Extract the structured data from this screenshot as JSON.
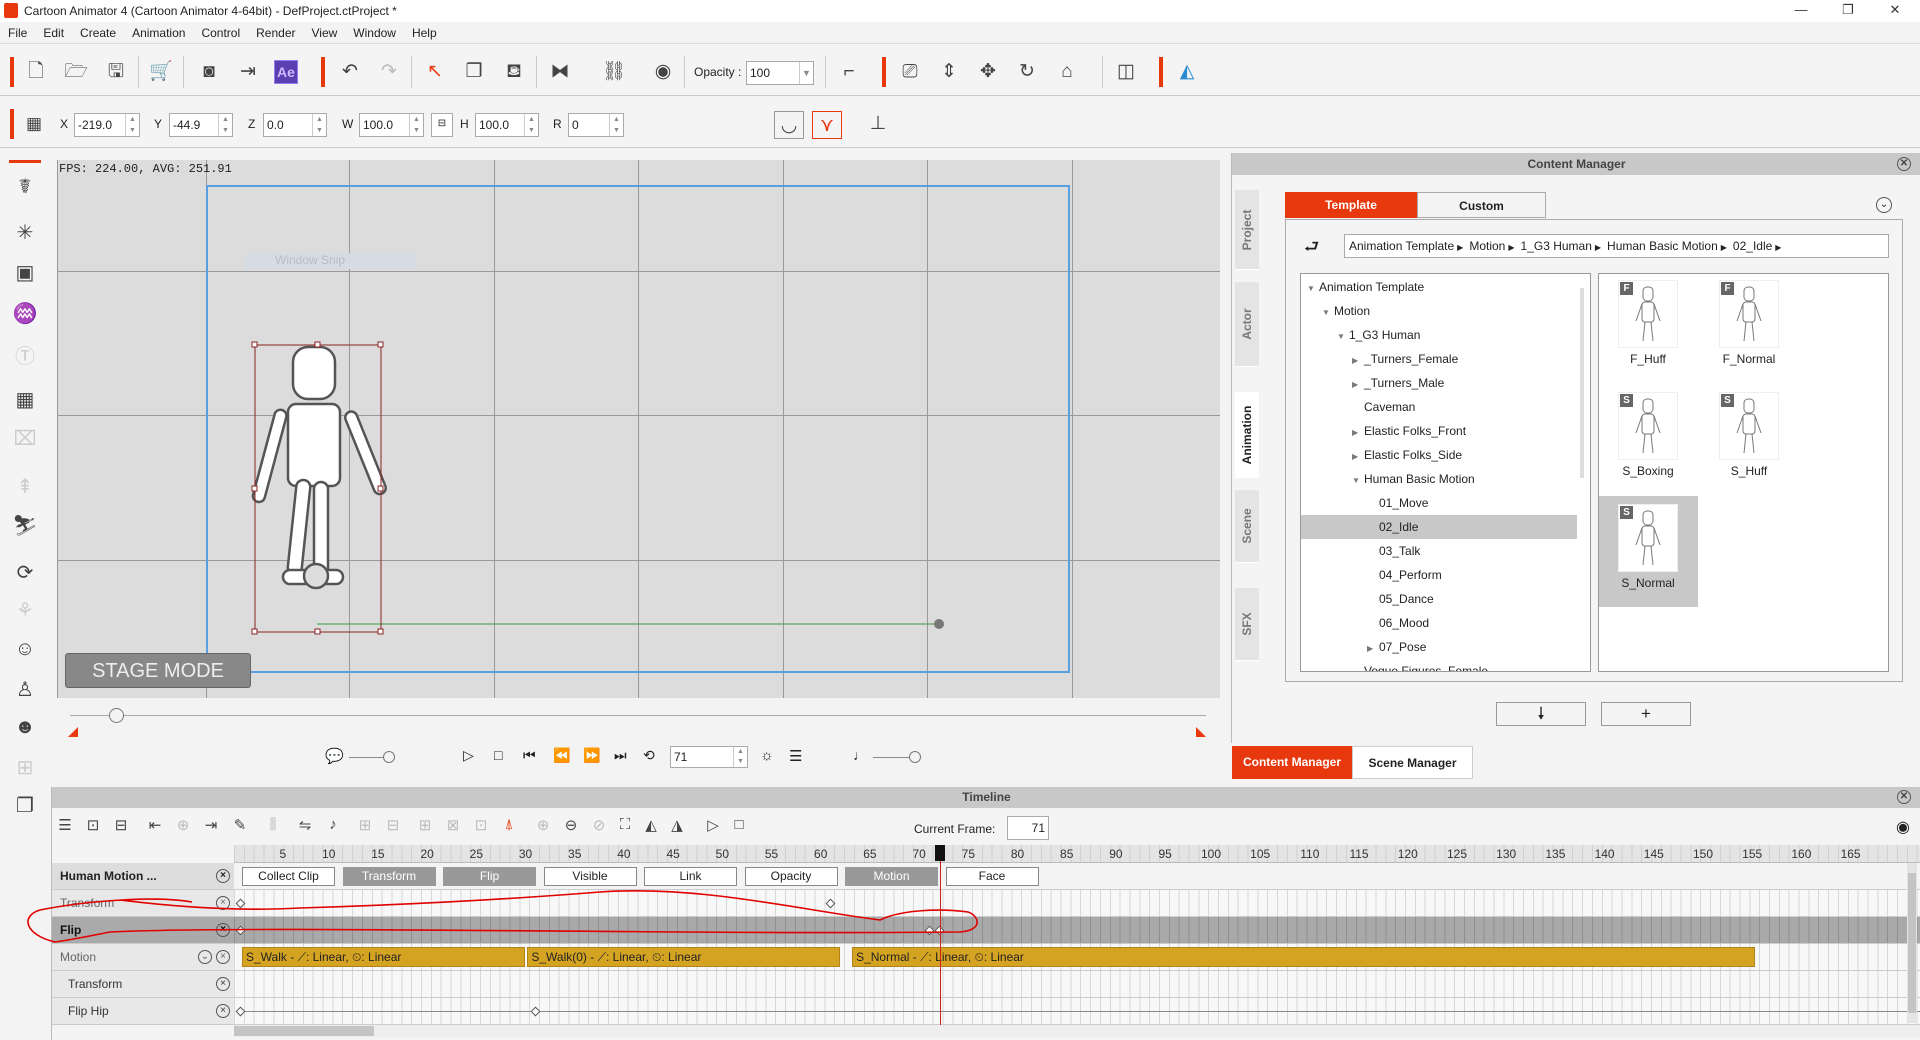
{
  "window": {
    "title": "Cartoon Animator 4  (Cartoon Animator 4-64bit) - DefProject.ctProject *",
    "minimize": "—",
    "restore": "❐",
    "close": "✕"
  },
  "menu": [
    "File",
    "Edit",
    "Create",
    "Animation",
    "Control",
    "Render",
    "View",
    "Window",
    "Help"
  ],
  "toolbar": {
    "opacity_label": "Opacity :",
    "opacity_value": "100",
    "ae_label": "Ae"
  },
  "transform": {
    "x_label": "X",
    "x": "-219.0",
    "y_label": "Y",
    "y": "-44.9",
    "z_label": "Z",
    "z": "0.0",
    "w_label": "W",
    "w": "100.0",
    "h_label": "H",
    "h": "100.0",
    "r_label": "R",
    "r": "0"
  },
  "viewport": {
    "fps": "FPS: 224.00, AVG: 251.91",
    "stage_mode": "STAGE MODE",
    "watermark": "Window Snip"
  },
  "playback": {
    "frame": "71"
  },
  "content_manager": {
    "title": "Content Manager",
    "side_tabs": [
      "Project",
      "Actor",
      "Animation",
      "Scene",
      "SFX"
    ],
    "selected_side_tab": "Animation",
    "tabs": [
      "Template",
      "Custom"
    ],
    "breadcrumb": [
      "Animation Template",
      "Motion",
      "1_G3 Human",
      "Human Basic Motion",
      "02_Idle"
    ],
    "tree": [
      {
        "label": "Animation Template",
        "level": 0,
        "arrow": "down"
      },
      {
        "label": "Motion",
        "level": 1,
        "arrow": "down"
      },
      {
        "label": "1_G3 Human",
        "level": 2,
        "arrow": "down"
      },
      {
        "label": "_Turners_Female",
        "level": 3,
        "arrow": "right"
      },
      {
        "label": "_Turners_Male",
        "level": 3,
        "arrow": "right"
      },
      {
        "label": "Caveman",
        "level": 3,
        "arrow": ""
      },
      {
        "label": "Elastic Folks_Front",
        "level": 3,
        "arrow": "right"
      },
      {
        "label": "Elastic Folks_Side",
        "level": 3,
        "arrow": "right"
      },
      {
        "label": "Human Basic Motion",
        "level": 3,
        "arrow": "down"
      },
      {
        "label": "01_Move",
        "level": 4,
        "arrow": ""
      },
      {
        "label": "02_Idle",
        "level": 4,
        "arrow": "",
        "selected": true
      },
      {
        "label": "03_Talk",
        "level": 4,
        "arrow": ""
      },
      {
        "label": "04_Perform",
        "level": 4,
        "arrow": ""
      },
      {
        "label": "05_Dance",
        "level": 4,
        "arrow": ""
      },
      {
        "label": "06_Mood",
        "level": 4,
        "arrow": ""
      },
      {
        "label": "07_Pose",
        "level": 4,
        "arrow": "right"
      },
      {
        "label": "Vogue Figures_Female",
        "level": 3,
        "arrow": ""
      }
    ],
    "thumbnails": [
      {
        "label": "F_Huff",
        "badge": "F"
      },
      {
        "label": "F_Normal",
        "badge": "F"
      },
      {
        "label": "S_Boxing",
        "badge": "S"
      },
      {
        "label": "S_Huff",
        "badge": "S"
      },
      {
        "label": "S_Normal",
        "badge": "S",
        "selected": true
      }
    ],
    "apply_icon": "🠗",
    "add_icon": "+",
    "bottom_tabs": [
      "Content Manager",
      "Scene Manager"
    ]
  },
  "timeline": {
    "title": "Timeline",
    "current_frame_label": "Current Frame:",
    "current_frame": "71",
    "ruler": [
      5,
      10,
      15,
      20,
      25,
      30,
      35,
      40,
      45,
      50,
      55,
      60,
      65,
      70,
      75,
      80,
      85,
      90,
      95,
      100,
      105,
      110,
      115,
      120,
      125,
      130,
      135,
      140,
      145,
      150,
      155,
      160,
      165
    ],
    "header_row": {
      "label": "Human Motion ...",
      "segments": [
        {
          "label": "Collect Clip",
          "on": false
        },
        {
          "label": "Transform",
          "on": true
        },
        {
          "label": "Flip",
          "on": true
        },
        {
          "label": "Visible",
          "on": false
        },
        {
          "label": "Link",
          "on": false
        },
        {
          "label": "Opacity",
          "on": false
        },
        {
          "label": "Motion",
          "on": true
        },
        {
          "label": "Face",
          "on": false
        }
      ]
    },
    "rows": [
      {
        "label": "Transform",
        "keys": [
          0,
          60
        ]
      },
      {
        "label": "Flip",
        "keys": [
          0,
          70,
          71
        ],
        "selected": true
      },
      {
        "label": "Motion",
        "clips": [
          {
            "label": "S_Walk - ⟋: Linear, ⏲: Linear",
            "start": 0,
            "end": 29
          },
          {
            "label": "S_Walk(0) - ⟋: Linear, ⏲: Linear",
            "start": 29,
            "end": 61
          },
          {
            "label": "S_Normal - ⟋: Linear, ⏲: Linear",
            "start": 62,
            "end": 154
          }
        ]
      },
      {
        "label": "Transform",
        "keys": []
      },
      {
        "label": "Flip Hip",
        "keys": [
          0,
          30
        ],
        "line": true
      }
    ],
    "playhead": 71
  },
  "colors": {
    "accent": "#e8380d",
    "clip": "#d4a322",
    "stage_frame": "#5aa0e0",
    "annotation": "#e00000"
  }
}
